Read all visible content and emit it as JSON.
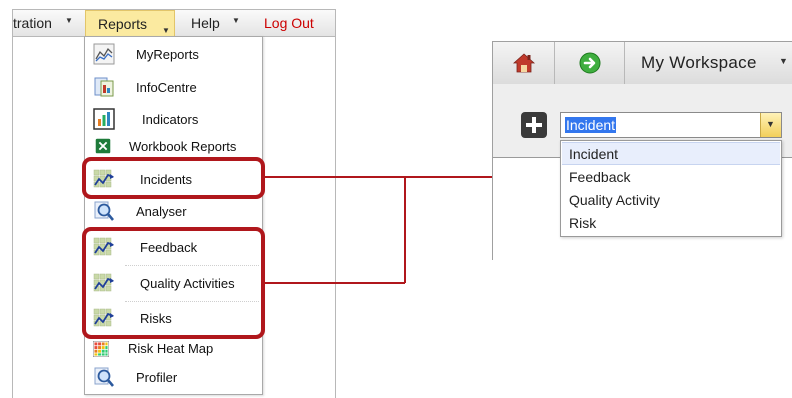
{
  "menubar": {
    "items": [
      {
        "label": "tration",
        "has_caret": true
      },
      {
        "label": "Reports",
        "has_caret": true,
        "active": true
      },
      {
        "label": "Help",
        "has_caret": true
      },
      {
        "label": "Log Out",
        "color": "#cc0000"
      }
    ]
  },
  "reports_menu": {
    "items": [
      {
        "label": "MyReports",
        "icon": "chart-lines-icon"
      },
      {
        "label": "InfoCentre",
        "icon": "infocentre-icon"
      },
      {
        "label": "Indicators",
        "icon": "bar-chart-icon"
      },
      {
        "label": "Workbook Reports",
        "icon": "excel-icon"
      },
      {
        "label": "Incidents",
        "icon": "trend-grid-icon",
        "highlighted": true
      },
      {
        "label": "Analyser",
        "icon": "magnifier-icon"
      },
      {
        "label": "Feedback",
        "icon": "trend-grid-icon",
        "highlighted": true
      },
      {
        "label": "Quality Activities",
        "icon": "trend-grid-icon",
        "highlighted": true
      },
      {
        "label": "Risks",
        "icon": "trend-grid-icon",
        "highlighted": true
      },
      {
        "label": "Risk Heat Map",
        "icon": "heat-map-icon"
      },
      {
        "label": "Profiler",
        "icon": "magnifier-icon"
      }
    ]
  },
  "workspace": {
    "toolbar": {
      "title": "My Workspace",
      "icons": [
        "home-icon",
        "refresh-icon"
      ]
    },
    "combo": {
      "selected": "Incident"
    },
    "options": [
      "Incident",
      "Feedback",
      "Quality Activity",
      "Risk"
    ]
  },
  "colors": {
    "highlight": "#b0171c",
    "selection": "#3377ee",
    "menu_active": "#fbeaa0"
  }
}
